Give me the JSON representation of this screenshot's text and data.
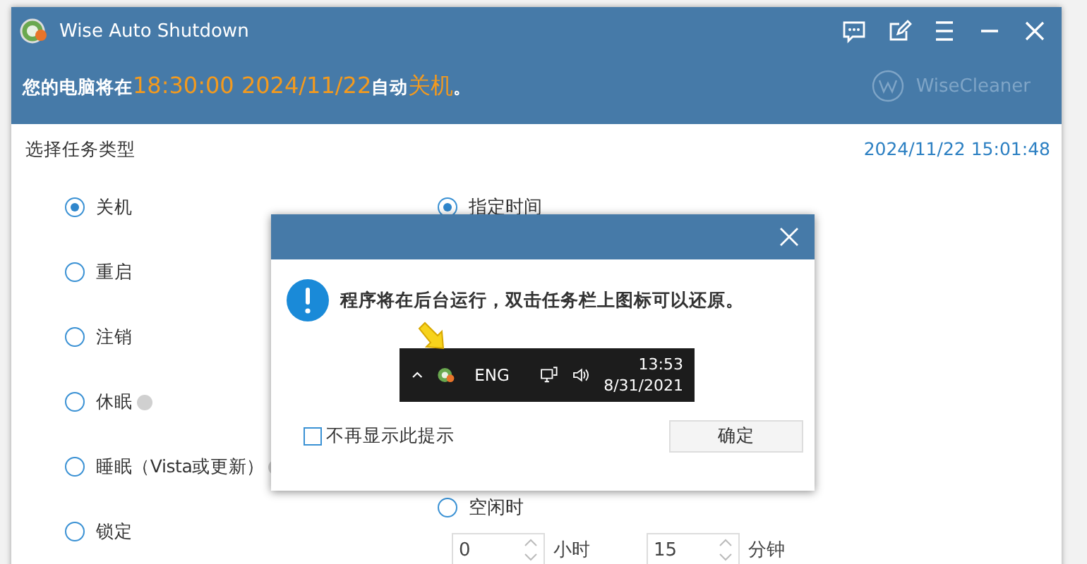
{
  "window": {
    "title": "Wise Auto Shutdown"
  },
  "banner": [
    {
      "text": "您的电脑将在",
      "highlight": false
    },
    {
      "text": "18:30:00 2024/11/22",
      "highlight": true
    },
    {
      "text": "自动",
      "highlight": false
    },
    {
      "text": "关机",
      "highlight": true
    },
    {
      "text": "。",
      "highlight": false
    }
  ],
  "brand": "WiseCleaner",
  "section_title": "选择任务类型",
  "clock": "2024/11/22 15:01:48",
  "task_types": [
    {
      "label": "关机",
      "selected": true,
      "info": false
    },
    {
      "label": "重启",
      "selected": false,
      "info": false
    },
    {
      "label": "注销",
      "selected": false,
      "info": false
    },
    {
      "label": "休眠",
      "selected": false,
      "info": true
    },
    {
      "label": "睡眠（Vista或更新）",
      "selected": false,
      "info": true
    },
    {
      "label": "锁定",
      "selected": false,
      "info": false
    }
  ],
  "time_options": [
    {
      "label": "指定时间",
      "selected": true
    },
    {
      "label": "空闲时",
      "selected": false
    }
  ],
  "idle": {
    "hours": "0",
    "hours_unit": "小时",
    "minutes": "15",
    "minutes_unit": "分钟"
  },
  "dialog": {
    "message": "程序将在后台运行，双击任务栏上图标可以还原。",
    "tray": {
      "lang": "ENG",
      "time": "13:53",
      "date": "8/31/2021"
    },
    "dont_show": {
      "label": "不再显示此提示",
      "checked": false
    },
    "ok": "确定"
  }
}
